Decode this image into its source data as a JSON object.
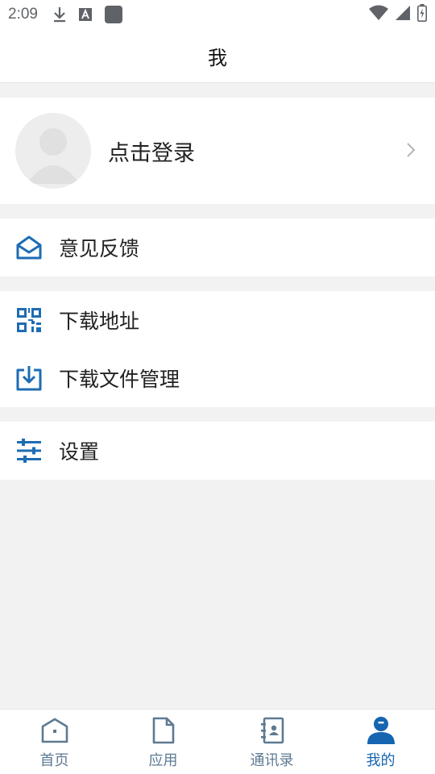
{
  "status_bar": {
    "time": "2:09",
    "left_icons": [
      "download-icon",
      "a-notification-icon",
      "app-square-icon"
    ],
    "right_icons": [
      "wifi-icon",
      "signal-icon",
      "battery-charging-icon"
    ]
  },
  "header": {
    "title": "我"
  },
  "profile": {
    "login_label": "点击登录",
    "avatar_icon": "default-avatar-icon",
    "chevron_icon": "chevron-right-icon"
  },
  "menu": {
    "feedback": {
      "label": "意见反馈",
      "icon": "envelope-open-icon"
    },
    "download_address": {
      "label": "下载地址",
      "icon": "qr-code-icon"
    },
    "download_manager": {
      "label": "下载文件管理",
      "icon": "download-tray-icon"
    },
    "settings": {
      "label": "设置",
      "icon": "sliders-icon"
    }
  },
  "tabs": [
    {
      "label": "首页",
      "icon": "home-icon"
    },
    {
      "label": "应用",
      "icon": "document-icon"
    },
    {
      "label": "通讯录",
      "icon": "contacts-book-icon"
    },
    {
      "label": "我的",
      "icon": "person-icon"
    }
  ],
  "active_tab": "我的",
  "colors": {
    "accent": "#1565b0",
    "icon_blue": "#1e6cb4",
    "tab_inactive": "#5e7a92",
    "background": "#f2f2f2"
  }
}
